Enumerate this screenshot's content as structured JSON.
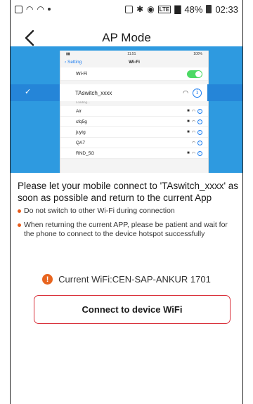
{
  "statusbar": {
    "battery": "48%",
    "time": "02:33",
    "network_badge": "LTE"
  },
  "header": {
    "title": "AP Mode"
  },
  "illustration": {
    "phone_time": "11:51",
    "phone_battery": "100%",
    "nav_back": "Setting",
    "nav_title": "Wi-Fi",
    "wifi_label": "Wi-Fi",
    "selected_network": "TAswitch_xxxx",
    "loading_text": "Loading...",
    "networks": [
      {
        "name": "Air",
        "locked": true
      },
      {
        "name": "cfq5g",
        "locked": true
      },
      {
        "name": "juytg",
        "locked": true
      },
      {
        "name": "QA7",
        "locked": false
      },
      {
        "name": "RND_5G",
        "locked": true
      }
    ]
  },
  "instructions": {
    "main": "Please let your mobile connect to 'TAswitch_xxxx' as soon as possible and return to the current App",
    "bullets": [
      "Do not switch to other Wi-Fi during connection",
      "When returning the current APP, please be patient and wait for the phone to connect to the device hotspot successfully"
    ]
  },
  "current_wifi": {
    "text": "Current WiFi:CEN-SAP-ANKUR 1701"
  },
  "connect_button": {
    "label": "Connect to device WiFi"
  },
  "colors": {
    "illustration_bg": "#2e9ae0",
    "bullet": "#e85b1a",
    "warning": "#e8651f",
    "button_border": "#d9303a",
    "toggle_on": "#4cd964"
  }
}
